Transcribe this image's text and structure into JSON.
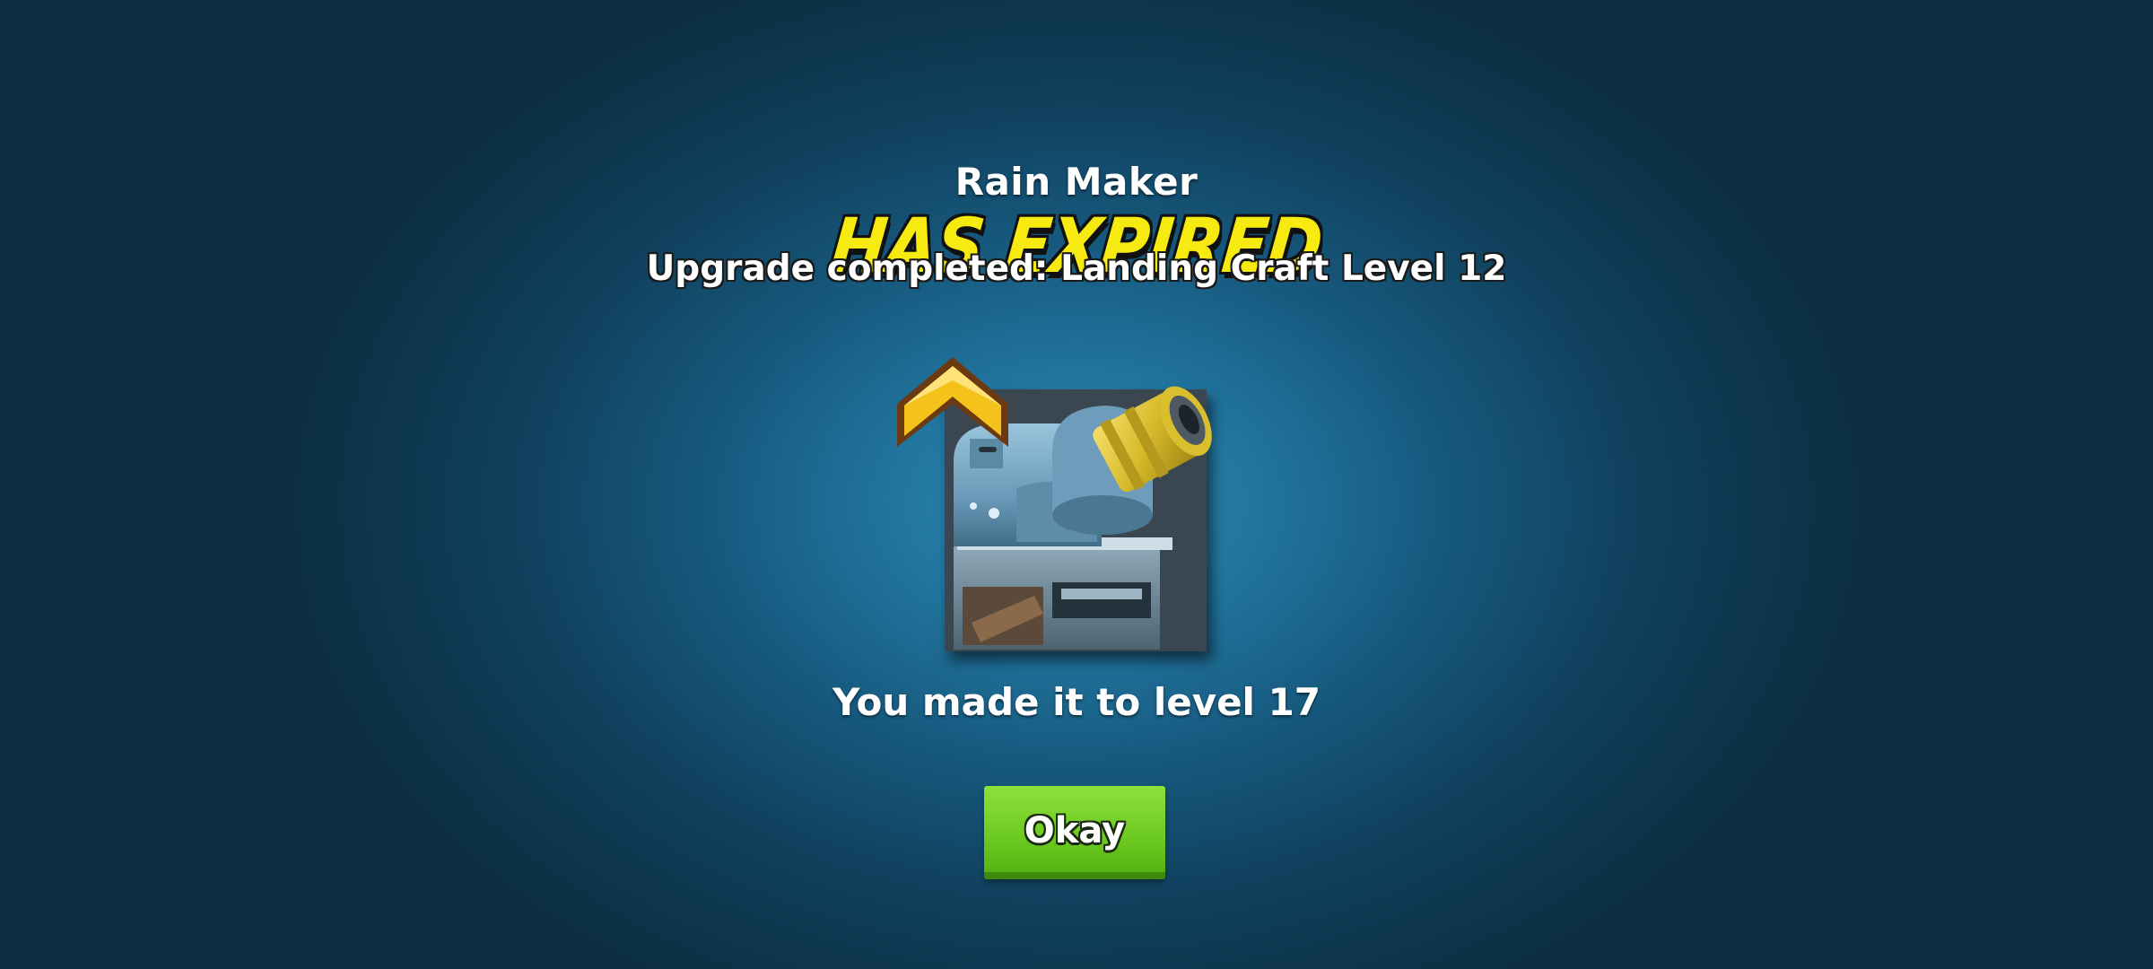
{
  "popup": {
    "item_name": "Rain Maker",
    "status_banner": "HAS EXPIRED",
    "upgrade_message": "Upgrade completed: Landing Craft Level 12",
    "level_message": "You made it to level 17",
    "okay_label": "Okay"
  },
  "icons": {
    "item_image": "rain-maker-cannon-icon",
    "upgrade_badge": "gold-chevron-rank-icon"
  },
  "colors": {
    "banner_yellow": "#f7ea10",
    "button_green": "#6fcc22",
    "background_blue": "#1d6a92"
  }
}
